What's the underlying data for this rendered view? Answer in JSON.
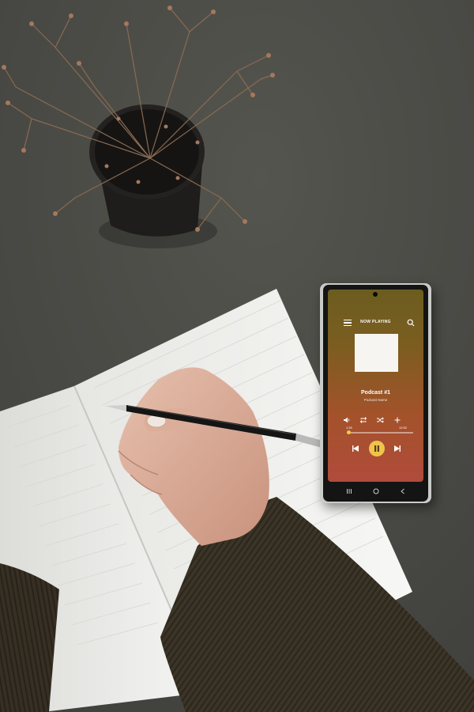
{
  "player": {
    "header": "NOW PLAYING",
    "track_title": "Podcast #1",
    "track_subtitle": "Podcast Name",
    "time_elapsed": "1:25",
    "time_total": "12:52",
    "progress_fraction": 0.03
  },
  "colors": {
    "desk": "#4a4a47",
    "accent": "#efc44c",
    "paper": "#f4f4f1",
    "sweater": "#3b3427"
  },
  "icons": [
    "menu-icon",
    "search-icon",
    "volume-icon",
    "repeat-icon",
    "shuffle-icon",
    "add-icon",
    "previous-icon",
    "pause-icon",
    "next-icon",
    "recents-icon",
    "home-icon",
    "back-icon"
  ]
}
